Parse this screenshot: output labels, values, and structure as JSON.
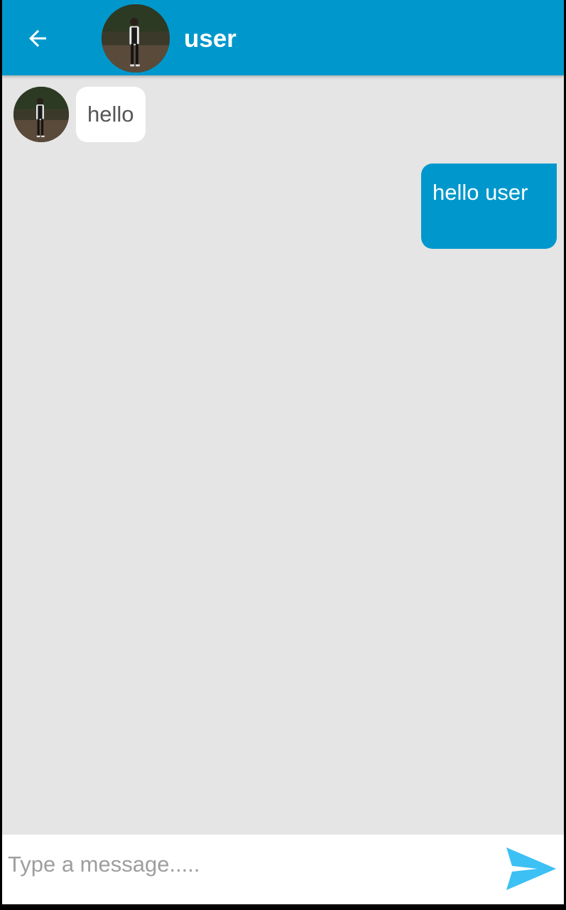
{
  "header": {
    "title": "user",
    "back_icon": "arrow-left-icon",
    "avatar_icon": "user-photo"
  },
  "messages": [
    {
      "direction": "incoming",
      "text": "hello"
    },
    {
      "direction": "outgoing",
      "text": "hello user"
    }
  ],
  "composer": {
    "placeholder": "Type a message.....",
    "value": "",
    "send_icon": "send-icon"
  },
  "colors": {
    "primary": "#0098cc",
    "background": "#e5e5e5",
    "incoming_bubble": "#ffffff",
    "send_icon": "#3dc0f4"
  }
}
